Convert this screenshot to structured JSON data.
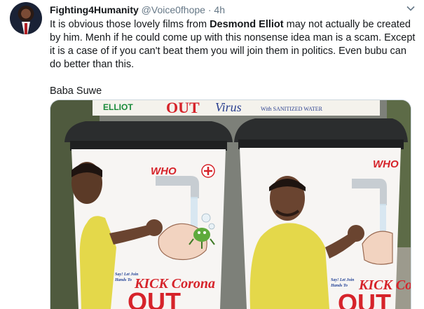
{
  "tweet": {
    "display_name": "Fighting4Humanity",
    "handle": "@Voice0fhope",
    "separator": "·",
    "time": "4h",
    "body_before": "It is obvious those lovely films from ",
    "body_bold": "Desmond Elliot",
    "body_after": " may not actually be created by him. Menh if he could come up with this nonsense idea man is a scam. Except it is a case of if you can't beat them you will join them in politics. Even bubu can do better than this.",
    "signature": "Baba Suwe"
  },
  "photo": {
    "banner_left": "ELLIOT",
    "banner_mid": "OUT",
    "banner_right": "Virus",
    "banner_small": "With SANITIZED WATER",
    "bin_label": "WHO",
    "slogan_small_line1": "Say! Let Join",
    "slogan_small_line2": "Hands To",
    "slogan_big": "KICK Corona",
    "slogan_out": "OUT"
  },
  "colors": {
    "accent": "#1da1f2",
    "bin_lid": "#2b2d2e",
    "who_red": "#d6232a",
    "shirt_yellow": "#e4d84a"
  }
}
